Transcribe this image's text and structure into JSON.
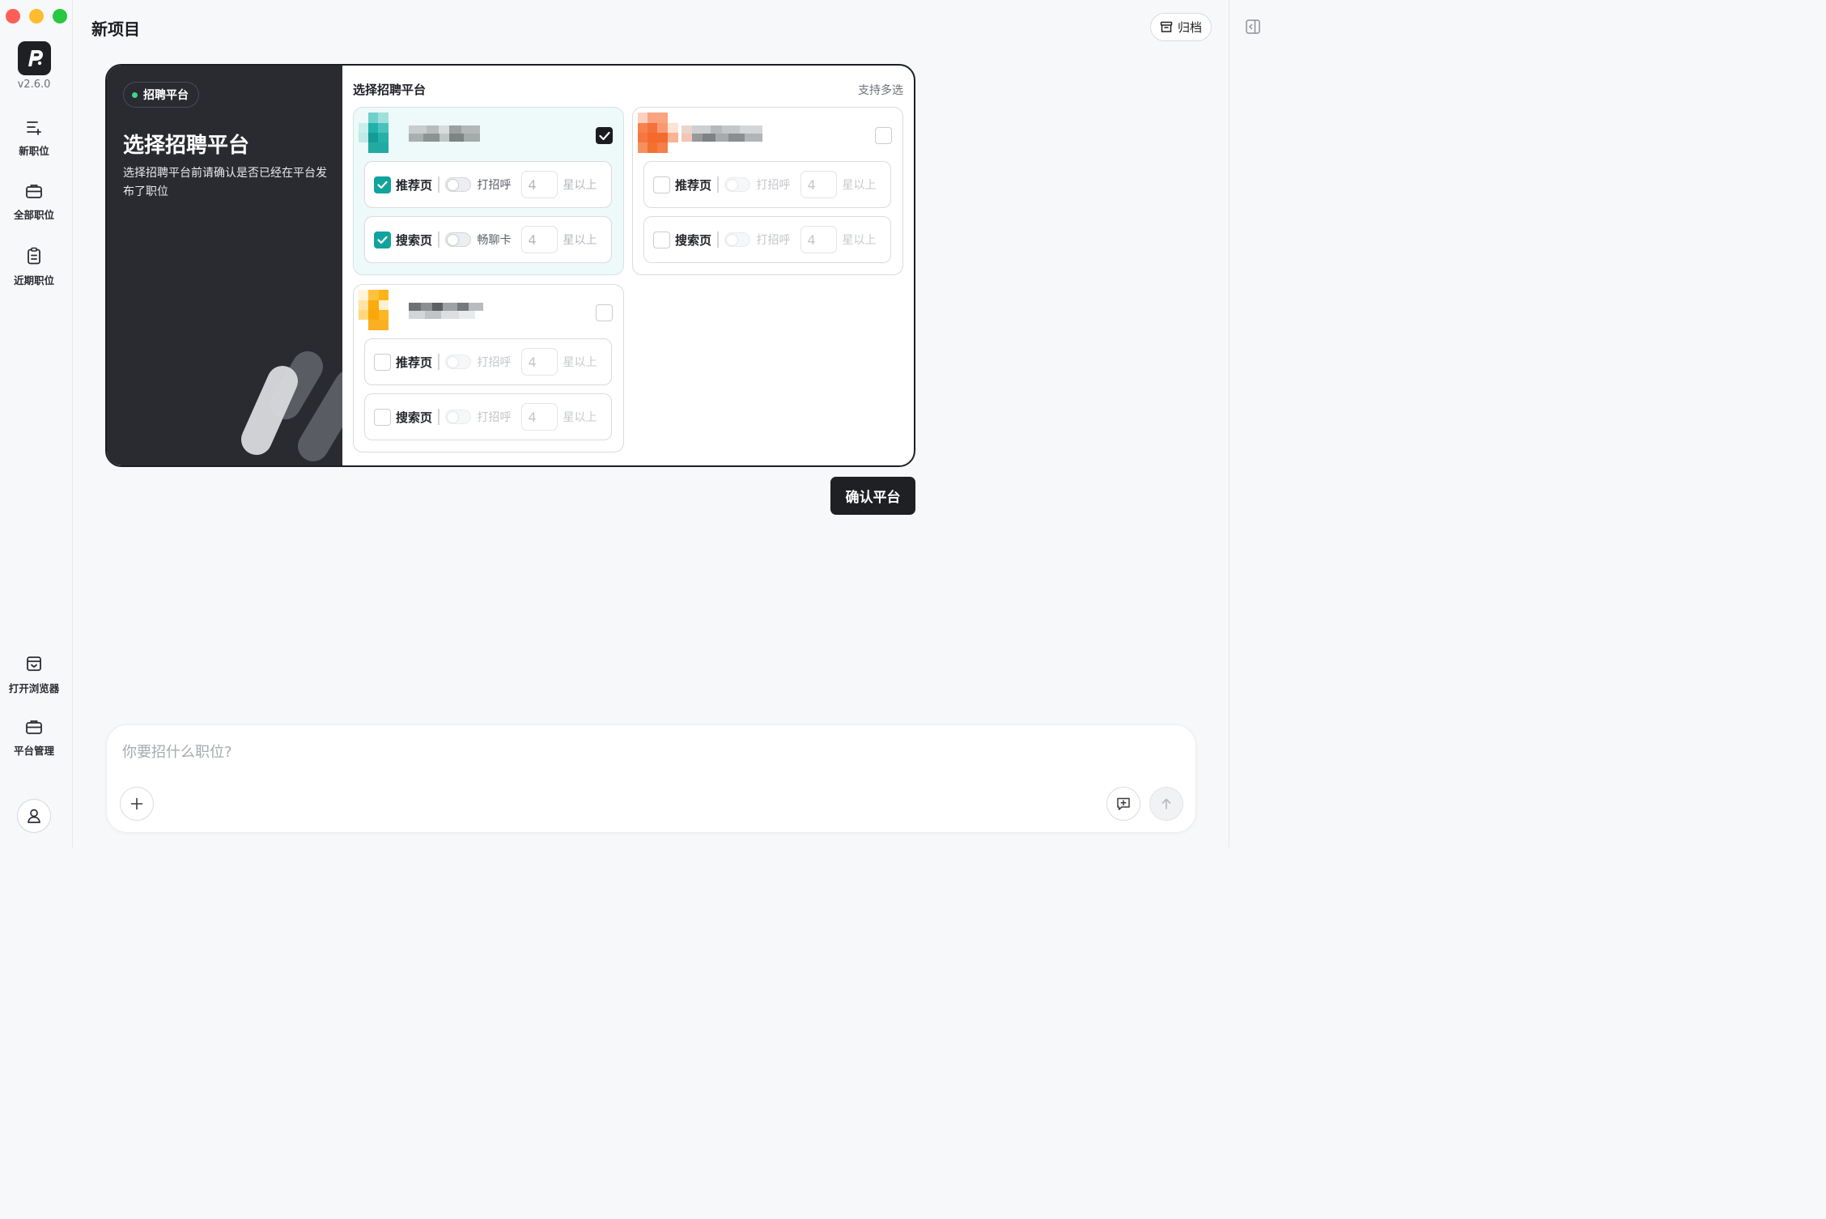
{
  "app": {
    "version": "v2.6.0"
  },
  "sidebar": {
    "items": [
      {
        "label": "新职位",
        "icon": "list-add-icon"
      },
      {
        "label": "全部职位",
        "icon": "briefcase-icon"
      },
      {
        "label": "近期职位",
        "icon": "clipboard-icon"
      }
    ],
    "bottom_items": [
      {
        "label": "打开浏览器",
        "icon": "browser-window-icon"
      },
      {
        "label": "平台管理",
        "icon": "briefcase-icon"
      }
    ]
  },
  "header": {
    "title": "新项目",
    "archive_label": "归档"
  },
  "card": {
    "badge": "招聘平台",
    "title": "选择招聘平台",
    "description": "选择招聘平台前请确认是否已经在平台发布了职位",
    "panel_title": "选择招聘平台",
    "panel_hint": "支持多选",
    "platforms": [
      {
        "selected": true,
        "options": [
          {
            "label": "推荐页",
            "checked": true,
            "toggle_label": "打招呼",
            "value": "4",
            "suffix": "星以上"
          },
          {
            "label": "搜索页",
            "checked": true,
            "toggle_label": "畅聊卡",
            "value": "4",
            "suffix": "星以上"
          }
        ]
      },
      {
        "selected": false,
        "options": [
          {
            "label": "推荐页",
            "checked": false,
            "toggle_label": "打招呼",
            "value": "4",
            "suffix": "星以上"
          },
          {
            "label": "搜索页",
            "checked": false,
            "toggle_label": "打招呼",
            "value": "4",
            "suffix": "星以上"
          }
        ]
      },
      {
        "selected": false,
        "options": [
          {
            "label": "推荐页",
            "checked": false,
            "toggle_label": "打招呼",
            "value": "4",
            "suffix": "星以上"
          },
          {
            "label": "搜索页",
            "checked": false,
            "toggle_label": "打招呼",
            "value": "4",
            "suffix": "星以上"
          }
        ]
      }
    ],
    "confirm_label": "确认平台"
  },
  "chat": {
    "placeholder": "你要招什么职位?"
  },
  "colors": {
    "accent": "#12a39c",
    "dark": "#2a2b31",
    "badge_dot": "#3ed58d"
  }
}
